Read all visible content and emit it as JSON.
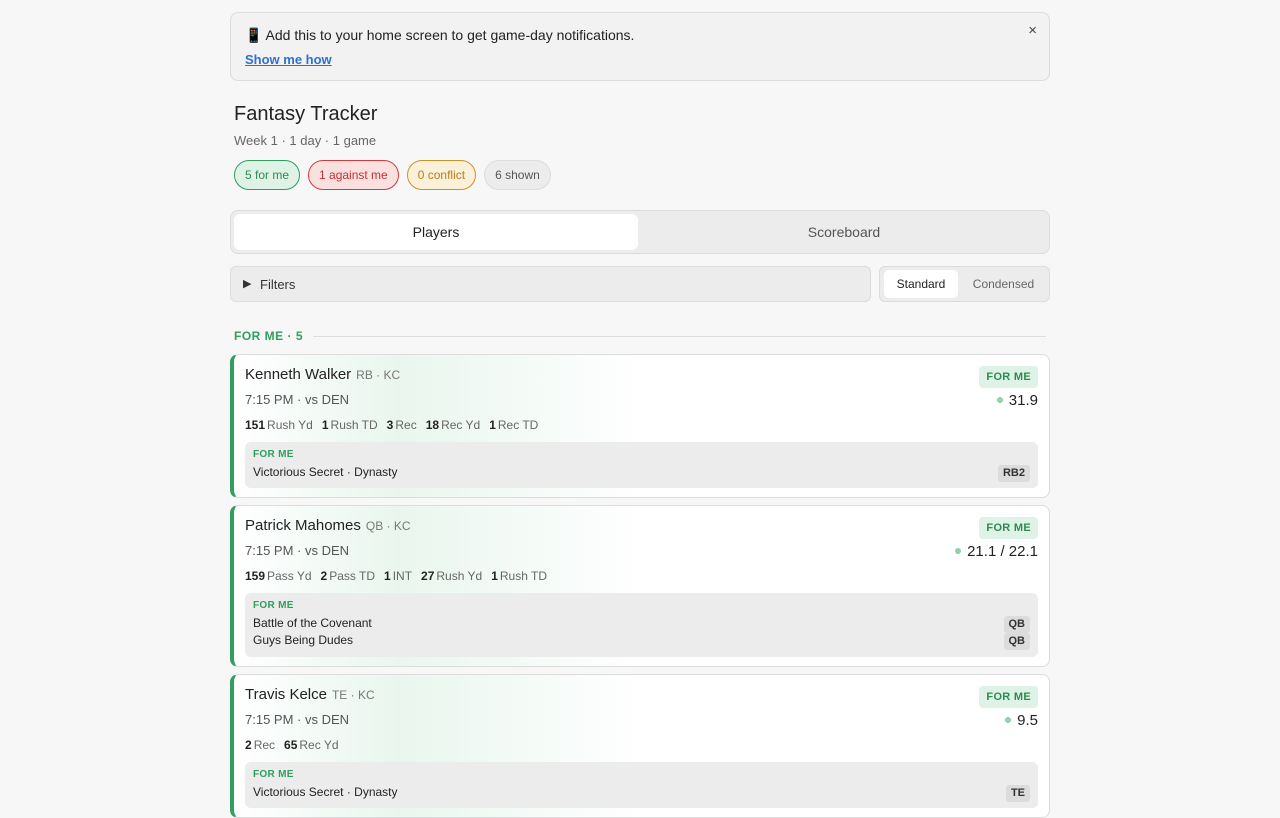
{
  "banner": {
    "icon": "phone-icon",
    "message": "📱 Add this to your home screen to get game-day notifications.",
    "link": "Show me how",
    "close": "×"
  },
  "header": {
    "title": "Fantasy Tracker",
    "subtitle": "Week 1 · 1 day · 1 game"
  },
  "chips": {
    "for_me": "5 for me",
    "against_me": "1 against me",
    "conflict": "0 conflict",
    "shown": "6 shown"
  },
  "tabs": {
    "players": "Players",
    "scoreboard": "Scoreboard"
  },
  "filters": {
    "arrow": "▶",
    "label": "Filters"
  },
  "view": {
    "standard": "Standard",
    "condensed": "Condensed"
  },
  "section": {
    "label": "FOR ME · 5"
  },
  "players": [
    {
      "name": "Kenneth Walker",
      "pos": "RB · KC",
      "time": "7:15 PM · vs DEN",
      "badge": "FOR ME",
      "score": "31.9",
      "stats": [
        {
          "v": "151",
          "l": "Rush Yd"
        },
        {
          "v": "1",
          "l": "Rush TD"
        },
        {
          "v": "3",
          "l": "Rec"
        },
        {
          "v": "18",
          "l": "Rec Yd"
        },
        {
          "v": "1",
          "l": "Rec TD"
        }
      ],
      "lineup_header": "FOR ME",
      "teams": [
        {
          "team": "Victorious Secret · Dynasty",
          "slot": "RB2"
        }
      ]
    },
    {
      "name": "Patrick Mahomes",
      "pos": "QB · KC",
      "time": "7:15 PM · vs DEN",
      "badge": "FOR ME",
      "score": "21.1 / 22.1",
      "stats": [
        {
          "v": "159",
          "l": "Pass Yd"
        },
        {
          "v": "2",
          "l": "Pass TD"
        },
        {
          "v": "1",
          "l": "INT"
        },
        {
          "v": "27",
          "l": "Rush Yd"
        },
        {
          "v": "1",
          "l": "Rush TD"
        }
      ],
      "lineup_header": "FOR ME",
      "teams": [
        {
          "team": "Battle of the Covenant",
          "slot": "QB"
        },
        {
          "team": "Guys Being Dudes",
          "slot": "QB"
        }
      ]
    },
    {
      "name": "Travis Kelce",
      "pos": "TE · KC",
      "time": "7:15 PM · vs DEN",
      "badge": "FOR ME",
      "score": "9.5",
      "stats": [
        {
          "v": "2",
          "l": "Rec"
        },
        {
          "v": "65",
          "l": "Rec Yd"
        }
      ],
      "lineup_header": "FOR ME",
      "teams": [
        {
          "team": "Victorious Secret · Dynasty",
          "slot": "TE"
        }
      ]
    }
  ]
}
